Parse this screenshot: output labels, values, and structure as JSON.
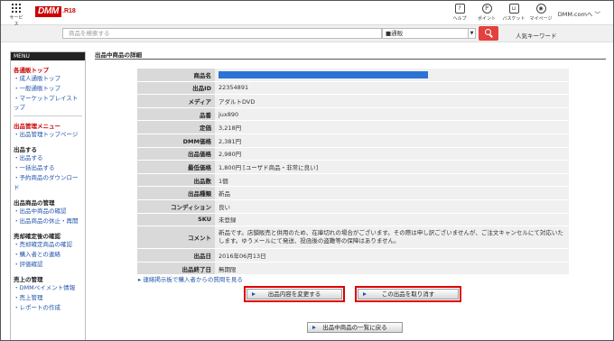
{
  "header": {
    "services_label": "サービス",
    "logo_text": "DMM",
    "logo_sub": ".R18",
    "icons": [
      {
        "name": "help-icon",
        "glyph": "?",
        "label": "ヘルプ"
      },
      {
        "name": "points-icon",
        "glyph": "P",
        "label": "ポイント"
      },
      {
        "name": "basket-icon",
        "glyph": "⊔",
        "label": "バスケット"
      },
      {
        "name": "mypage-icon",
        "glyph": "◉",
        "label": "マイページ"
      }
    ],
    "account_label": "DMM.comへ ﹀"
  },
  "search": {
    "placeholder": "商品を検索する",
    "category_value": "■通販",
    "popular_label": "人気キーワード"
  },
  "sidebar": {
    "menu_title": "MENU",
    "top_title": "各通販トップ",
    "top_links": [
      "・成人通販トップ",
      "・一般通販トップ",
      "・マーケットプレイストップ"
    ],
    "listing_title": "出品管理メニュー",
    "listing_links": [
      "・出品管理トップページ"
    ],
    "sections": [
      {
        "title": "出品する",
        "links": [
          "・出品する",
          "・一括出品する",
          "・予約商品のダウンロード"
        ]
      },
      {
        "title": "出品商品の管理",
        "links": [
          "・出品中商品の確認",
          "・出品商品の休止・再開"
        ]
      },
      {
        "title": "売却確定後の確認",
        "links": [
          "・売却確定商品の確認",
          "・購入者との連絡",
          "・評価確認"
        ]
      },
      {
        "title": "売上の管理",
        "links": [
          "・DMMペイメント情報",
          "・売上管理",
          "・レポートの作成"
        ]
      }
    ]
  },
  "main": {
    "page_title": "出品中商品の詳細",
    "rows": [
      {
        "label": "商品名",
        "value": ""
      },
      {
        "label": "出品ID",
        "value": "22354891"
      },
      {
        "label": "メディア",
        "value": "アダルトDVD"
      },
      {
        "label": "品番",
        "value": "jux890"
      },
      {
        "label": "定価",
        "value": "3,218円"
      },
      {
        "label": "DMM価格",
        "value": "2,381円"
      },
      {
        "label": "出品価格",
        "value": "2,980円"
      },
      {
        "label": "最低価格",
        "value": "1,800円 [ユーザド商品・非常に良い]"
      },
      {
        "label": "出品数",
        "value": "1個"
      },
      {
        "label": "出品種類",
        "value": "新品"
      },
      {
        "label": "コンディション",
        "value": "良い"
      },
      {
        "label": "SKU",
        "value": "未登録"
      },
      {
        "label": "コメント",
        "value": "新品です。店舗販売と併用のため、在庫切れの場合がございます。その際は申し訳ございませんが、ご注文キャンセルにて対応いたします。ゆうメールにて発送、投函後の盗難等の保障はありません。"
      },
      {
        "label": "出品日",
        "value": "2016年06月13日"
      },
      {
        "label": "出品終了日",
        "value": "無期限"
      }
    ],
    "inquiry_link": "▸ 連絡掲示板で購入者からの質問を見る",
    "edit_button": "出品内容を変更する",
    "cancel_button": "この出品を取り消す",
    "back_button": "出品中商品の一覧に戻る"
  },
  "colors": {
    "brand": "#cc0000",
    "search_button": "#e3413e",
    "highlight_border": "#dd0000",
    "link": "#2255aa"
  }
}
